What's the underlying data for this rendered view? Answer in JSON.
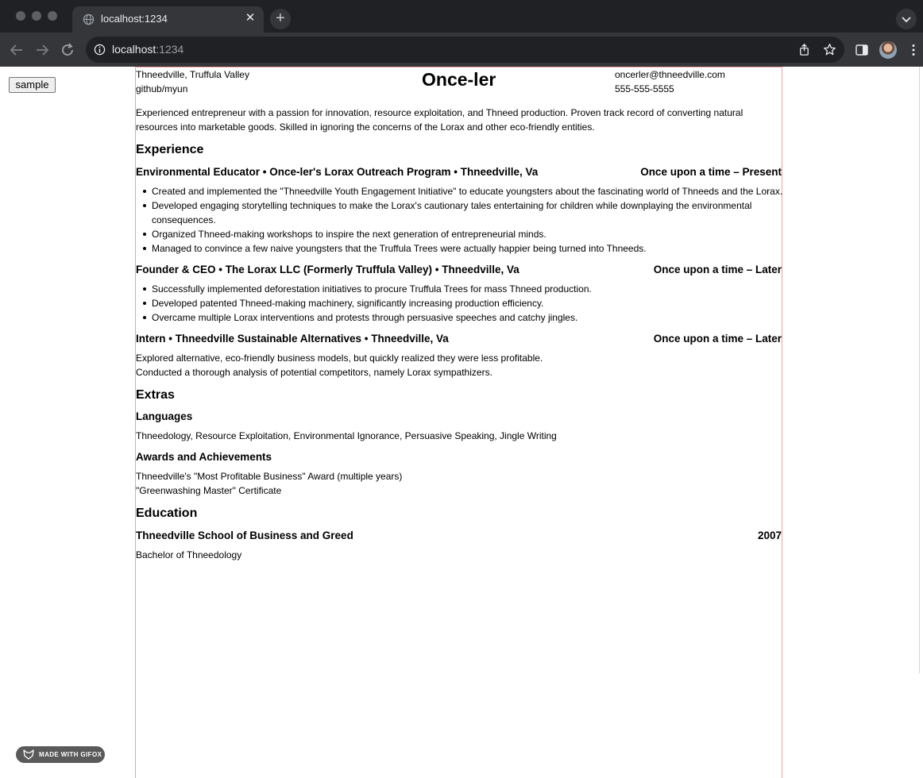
{
  "browser": {
    "tab_title": "localhost:1234",
    "tab_close": "✕",
    "new_tab": "+",
    "url_host": "localhost",
    "url_port": ":1234"
  },
  "page": {
    "sample_button": "sample"
  },
  "resume": {
    "name": "Once-ler",
    "location": "Thneedville, Truffula Valley",
    "github": "github/myun",
    "email": "oncerler@thneedville.com",
    "phone": "555-555-5555",
    "summary": "Experienced entrepreneur with a passion for innovation, resource exploitation, and Thneed production. Proven track record of converting natural resources into marketable goods. Skilled in ignoring the concerns of the Lorax and other eco-friendly entities.",
    "experience": {
      "heading": "Experience",
      "jobs": [
        {
          "title": "Environmental Educator • Once-ler's Lorax Outreach Program • Thneedville, Va",
          "dates": "Once upon a time – Present",
          "bullets": [
            "Created and implemented the \"Thneedville Youth Engagement Initiative\" to educate youngsters about the fascinating world of Thneeds and the Lorax.",
            "Developed engaging storytelling techniques to make the Lorax's cautionary tales entertaining for children while downplaying the environmental",
            "consequences.",
            "Organized Thneed-making workshops to inspire the next generation of entrepreneurial minds.",
            "Managed to convince a few naive youngsters that the Truffula Trees were actually happier being turned into Thneeds."
          ]
        },
        {
          "title": "Founder & CEO • The Lorax LLC (Formerly Truffula Valley) • Thneedville, Va",
          "dates": "Once upon a time – Later",
          "bullets": [
            "Successfully implemented deforestation initiatives to procure Truffula Trees for mass Thneed production.",
            "Developed patented Thneed-making machinery, significantly increasing production efficiency.",
            "Overcame multiple Lorax interventions and protests through persuasive speeches and catchy jingles."
          ]
        },
        {
          "title": "Intern • Thneedville Sustainable Alternatives • Thneedville, Va",
          "dates": "Once upon a time – Later",
          "lines": [
            "Explored alternative, eco-friendly business models, but quickly realized they were less profitable.",
            "Conducted a thorough analysis of potential competitors, namely Lorax sympathizers."
          ]
        }
      ]
    },
    "extras": {
      "heading": "Extras",
      "languages_heading": "Languages",
      "languages": "Thneedology, Resource Exploitation, Environmental Ignorance, Persuasive Speaking, Jingle Writing",
      "awards_heading": "Awards and Achievements",
      "awards": [
        "Thneedville's \"Most Profitable Business\" Award (multiple years)",
        "\"Greenwashing Master\" Certificate"
      ]
    },
    "education": {
      "heading": "Education",
      "school": "Thneedville School of Business and Greed",
      "year": "2007",
      "degree": "Bachelor of Thneedology"
    }
  },
  "overlay": {
    "gifox_label": "MADE WITH GIFOX"
  }
}
